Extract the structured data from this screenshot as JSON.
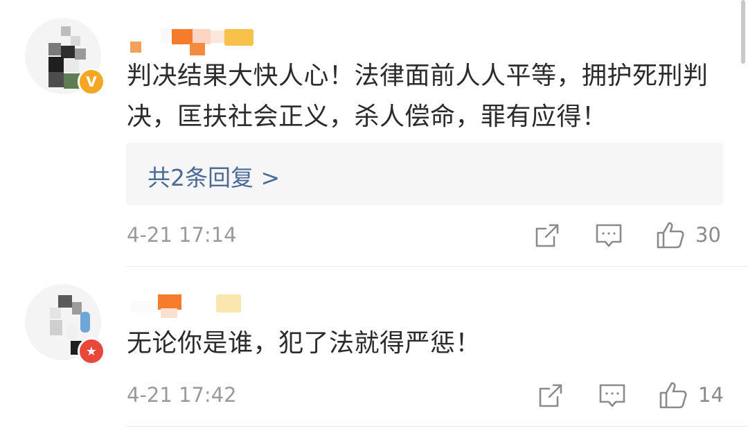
{
  "comments": [
    {
      "text": "判决结果大快人心！法律面前人人平等，拥护死刑判决，匡扶社会正义，杀人偿命，罪有应得！",
      "replies_label": "共2条回复 >",
      "time": "4-21 17:14",
      "likes": "30",
      "badge": "V",
      "badge_icon": "verified-v-icon"
    },
    {
      "text": "无论你是谁，犯了法就得严惩！",
      "time": "4-21 17:42",
      "likes": "14",
      "badge": "★",
      "badge_icon": "star-badge-icon"
    }
  ],
  "colors": {
    "reply_link": "#4a6b96",
    "meta_text": "#9a9a9a",
    "reply_bg": "#f6f6f6",
    "badge_orange": "#f5a623",
    "badge_red": "#e8483a"
  },
  "icons": [
    "share-icon",
    "comment-icon",
    "like-icon"
  ]
}
